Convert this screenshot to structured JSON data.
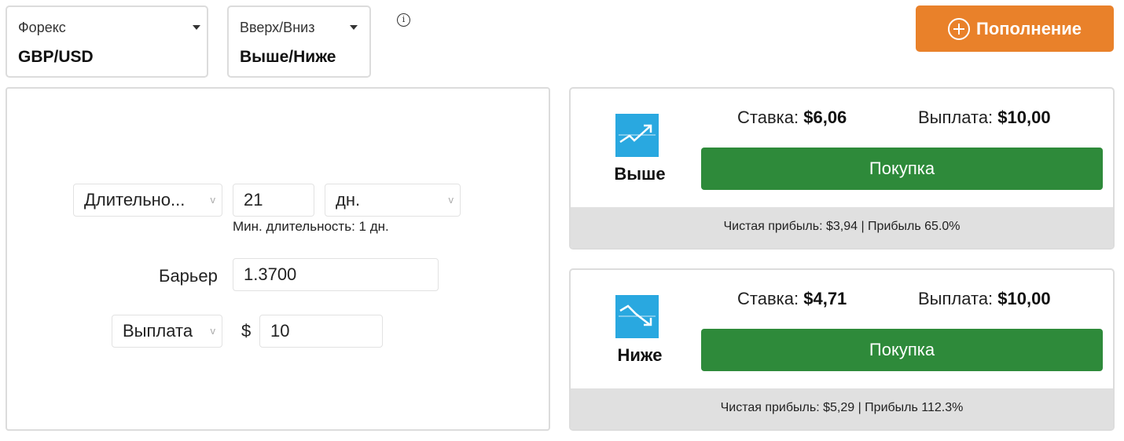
{
  "market_selector": {
    "category": "Форекс",
    "value": "GBP/USD"
  },
  "trade_type_selector": {
    "category": "Вверх/Вниз",
    "value": "Выше/Ниже"
  },
  "info_icon": "ⓘ",
  "deposit_button": {
    "label": "Пополнение",
    "icon": "plus-circle-icon",
    "color": "#e9812a"
  },
  "form": {
    "duration_type": "Длительно...",
    "duration_value": "21",
    "duration_unit": "дн.",
    "min_duration_hint": "Мин. длительность: 1 дн.",
    "barrier_label": "Барьер",
    "barrier_value": "1.3700",
    "basis_select": "Выплата",
    "currency_symbol": "$",
    "amount_value": "10"
  },
  "contracts": [
    {
      "label": "Выше",
      "icon": "rise-arrow-icon",
      "stake_label": "Ставка:",
      "stake_value": "$6,06",
      "payout_label": "Выплата:",
      "payout_value": "$10,00",
      "buy_label": "Покупка",
      "profit_text": "Чистая прибыль: $3,94 | Прибыль 65.0%"
    },
    {
      "label": "Ниже",
      "icon": "fall-arrow-icon",
      "stake_label": "Ставка:",
      "stake_value": "$4,71",
      "payout_label": "Выплата:",
      "payout_value": "$10,00",
      "buy_label": "Покупка",
      "profit_text": "Чистая прибыль: $5,29 | Прибыль 112.3%"
    }
  ],
  "colors": {
    "buy": "#2e8a3a",
    "icon_bg": "#29a8e0",
    "profit_bar": "#e0e0e0"
  }
}
